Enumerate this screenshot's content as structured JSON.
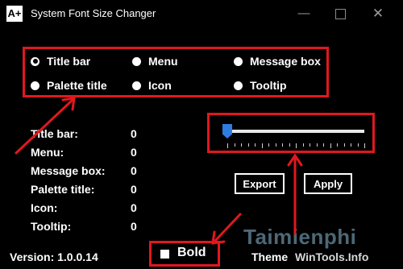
{
  "window": {
    "title": "System Font Size Changer",
    "icon_text": "A+",
    "controls": {
      "minimize": "—",
      "close": "✕"
    }
  },
  "targets": [
    {
      "label": "Title bar",
      "checked": true
    },
    {
      "label": "Menu",
      "checked": false
    },
    {
      "label": "Message box",
      "checked": false
    },
    {
      "label": "Palette title",
      "checked": false
    },
    {
      "label": "Icon",
      "checked": false
    },
    {
      "label": "Tooltip",
      "checked": false
    }
  ],
  "sizes": [
    {
      "label": "Title bar:",
      "value": "0"
    },
    {
      "label": "Menu:",
      "value": "0"
    },
    {
      "label": "Message box:",
      "value": "0"
    },
    {
      "label": "Palette title:",
      "value": "0"
    },
    {
      "label": "Icon:",
      "value": "0"
    },
    {
      "label": "Tooltip:",
      "value": "0"
    }
  ],
  "slider": {
    "value": 0,
    "min": 0,
    "max": 20
  },
  "buttons": {
    "export": "Export",
    "apply": "Apply"
  },
  "bold": {
    "label": "Bold",
    "checked": false
  },
  "footer": {
    "version": "Version: 1.0.0.14",
    "theme": "Theme"
  },
  "watermark": {
    "logo": "Taimienphi",
    "sub": "WinTools.Info"
  },
  "colors": {
    "annotation": "#e0181e",
    "slider_thumb": "#2f7de1",
    "background": "#000000"
  }
}
